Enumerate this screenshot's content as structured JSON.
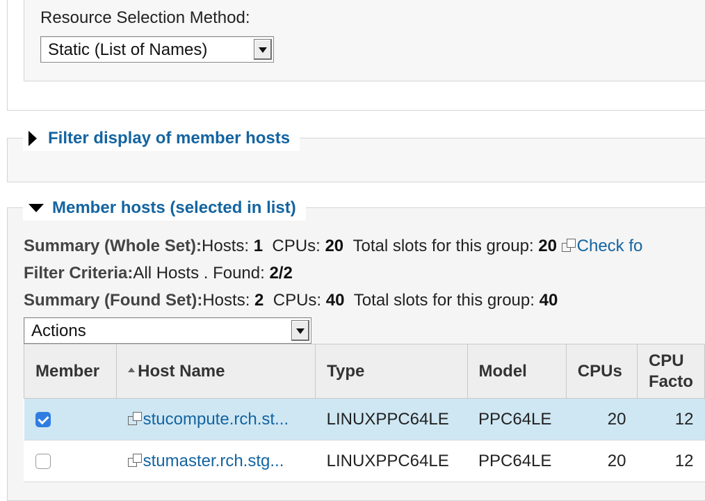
{
  "resource_selection": {
    "label": "Resource Selection Method:",
    "selected": "Static (List of Names)"
  },
  "filter_section": {
    "title": "Filter display of member hosts",
    "expanded": false
  },
  "members_section": {
    "title": "Member hosts (selected in list)",
    "expanded": true,
    "summary_whole": {
      "label": "Summary (Whole Set):",
      "hosts_label": "Hosts: ",
      "hosts": "1",
      "cpus_label": "CPUs: ",
      "cpus": "20",
      "slots_label": "Total slots for this group: ",
      "slots": "20",
      "check_link": "Check fo"
    },
    "filter_criteria": {
      "label": "Filter Criteria:",
      "text": "All Hosts . Found: ",
      "found": "2/2"
    },
    "summary_found": {
      "label": "Summary (Found Set):",
      "hosts_label": "Hosts: ",
      "hosts": "2",
      "cpus_label": "CPUs: ",
      "cpus": "40",
      "slots_label": "Total slots for this group: ",
      "slots": "40"
    },
    "actions_select": "Actions",
    "table": {
      "headers": {
        "member": "Member",
        "host_name": "Host Name",
        "type": "Type",
        "model": "Model",
        "cpus": "CPUs",
        "cpu_factor_1": "CPU",
        "cpu_factor_2": "Facto"
      },
      "rows": [
        {
          "checked": true,
          "host": "stucompute.rch.st...",
          "type": "LINUXPPC64LE",
          "model": "PPC64LE",
          "cpus": "20",
          "cpu_factor": "12"
        },
        {
          "checked": false,
          "host": "stumaster.rch.stg...",
          "type": "LINUXPPC64LE",
          "model": "PPC64LE",
          "cpus": "20",
          "cpu_factor": "12"
        }
      ]
    }
  },
  "colors": {
    "link": "#1464a0",
    "selected_row": "#cfe7f3",
    "checkbox_checked": "#2f7de1"
  }
}
